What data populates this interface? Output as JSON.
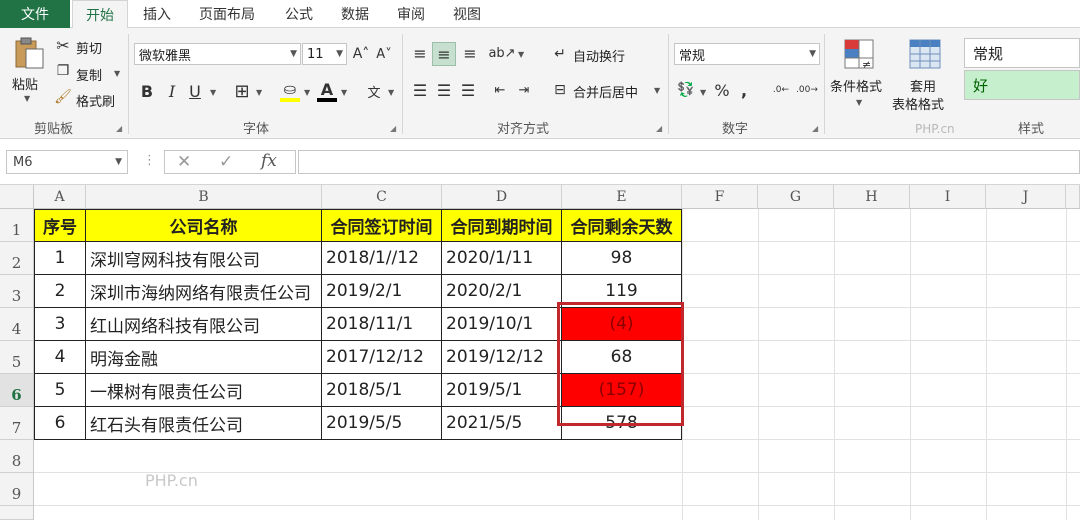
{
  "menu": {
    "file": "文件",
    "tabs": [
      "开始",
      "插入",
      "页面布局",
      "公式",
      "数据",
      "审阅",
      "视图"
    ]
  },
  "ribbon": {
    "clipboard": {
      "paste": "粘贴",
      "cut": "剪切",
      "copy": "复制",
      "format_painter": "格式刷",
      "label": "剪贴板"
    },
    "font": {
      "name": "微软雅黑",
      "size": "11",
      "bold": "B",
      "italic": "I",
      "underline": "U",
      "label": "字体"
    },
    "alignment": {
      "wrap": "自动换行",
      "merge": "合并后居中",
      "label": "对齐方式"
    },
    "number": {
      "format": "常规",
      "percent": "%",
      "comma": ",",
      "label": "数字"
    },
    "styles": {
      "conditional": "条件格式",
      "table1": "套用",
      "table2": "表格格式",
      "normal": "常规",
      "good": "好",
      "label": "样式"
    },
    "watermark": "PHP.cn"
  },
  "formula_bar": {
    "name_box": "M6",
    "fx": "fx",
    "value": ""
  },
  "columns": [
    "A",
    "B",
    "C",
    "D",
    "E",
    "F",
    "G",
    "H",
    "I",
    "J"
  ],
  "rows": [
    "1",
    "2",
    "3",
    "4",
    "5",
    "6",
    "7",
    "8",
    "9"
  ],
  "table": {
    "headers": [
      "序号",
      "公司名称",
      "合同签订时间",
      "合同到期时间",
      "合同剩余天数"
    ],
    "rows": [
      [
        "1",
        "深圳穹网科技有限公司",
        "2018/1//12",
        "2020/1/11",
        "98"
      ],
      [
        "2",
        "深圳市海纳网络有限责任公司",
        "2019/2/1",
        "2020/2/1",
        "119"
      ],
      [
        "3",
        "红山网络科技有限公司",
        "2018/11/1",
        "2019/10/1",
        "(4)"
      ],
      [
        "4",
        "明海金融",
        "2017/12/12",
        "2019/12/12",
        "68"
      ],
      [
        "5",
        "一棵树有限责任公司",
        "2018/5/1",
        "2019/5/1",
        "(157)"
      ],
      [
        "6",
        "红石头有限责任公司",
        "2019/5/5",
        "2021/5/5",
        "578"
      ]
    ]
  },
  "colors": {
    "accent": "#217346",
    "header_fill": "#ffff00",
    "negative_fill": "#ff0000",
    "box": "#c0282d"
  },
  "grid_watermark": "PHP.cn"
}
